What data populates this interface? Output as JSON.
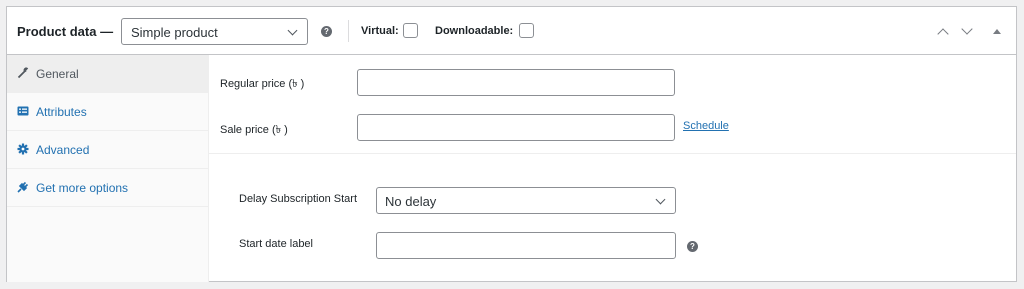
{
  "header": {
    "title": "Product data —",
    "product_type": "Simple product",
    "help_glyph": "?",
    "virtual_label": "Virtual:",
    "downloadable_label": "Downloadable:"
  },
  "tabs": [
    {
      "label": "General",
      "icon": "wrench-icon",
      "active": true
    },
    {
      "label": "Attributes",
      "icon": "list-view-icon",
      "active": false
    },
    {
      "label": "Advanced",
      "icon": "gear-icon",
      "active": false
    },
    {
      "label": "Get more options",
      "icon": "plugin-icon",
      "active": false
    }
  ],
  "general": {
    "regular_price_label": "Regular price (৳ )",
    "regular_price_value": "",
    "sale_price_label": "Sale price (৳ )",
    "sale_price_value": "",
    "schedule_link": "Schedule"
  },
  "subscription": {
    "delay_label": "Delay Subscription Start",
    "delay_value": "No delay",
    "start_date_label": "Start date label",
    "start_date_value": ""
  },
  "colors": {
    "link": "#2271b1",
    "border": "#8c8f94",
    "active_tab_bg": "#eeeeee"
  }
}
